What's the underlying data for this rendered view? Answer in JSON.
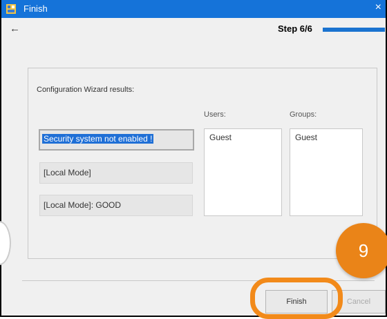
{
  "window": {
    "title": "Finish",
    "close_symbol": "×"
  },
  "nav": {
    "back_symbol": "←"
  },
  "wizard": {
    "step_label": "Step 6/6",
    "progress": 1.0
  },
  "results": {
    "title": "Configuration Wizard results:",
    "status_lines": [
      "Security system not enabled !",
      "[Local Mode]",
      "[Local Mode]: GOOD"
    ],
    "users_label": "Users:",
    "groups_label": "Groups:",
    "users": [
      "Guest"
    ],
    "groups": [
      "Guest"
    ]
  },
  "buttons": {
    "finish_label": "Finish",
    "cancel_label": "Cancel"
  },
  "annotation": {
    "badge_number": "9"
  },
  "colors": {
    "titlebar": "#1573d9",
    "accent": "#f28a1a",
    "selection": "#1f6fd6"
  }
}
